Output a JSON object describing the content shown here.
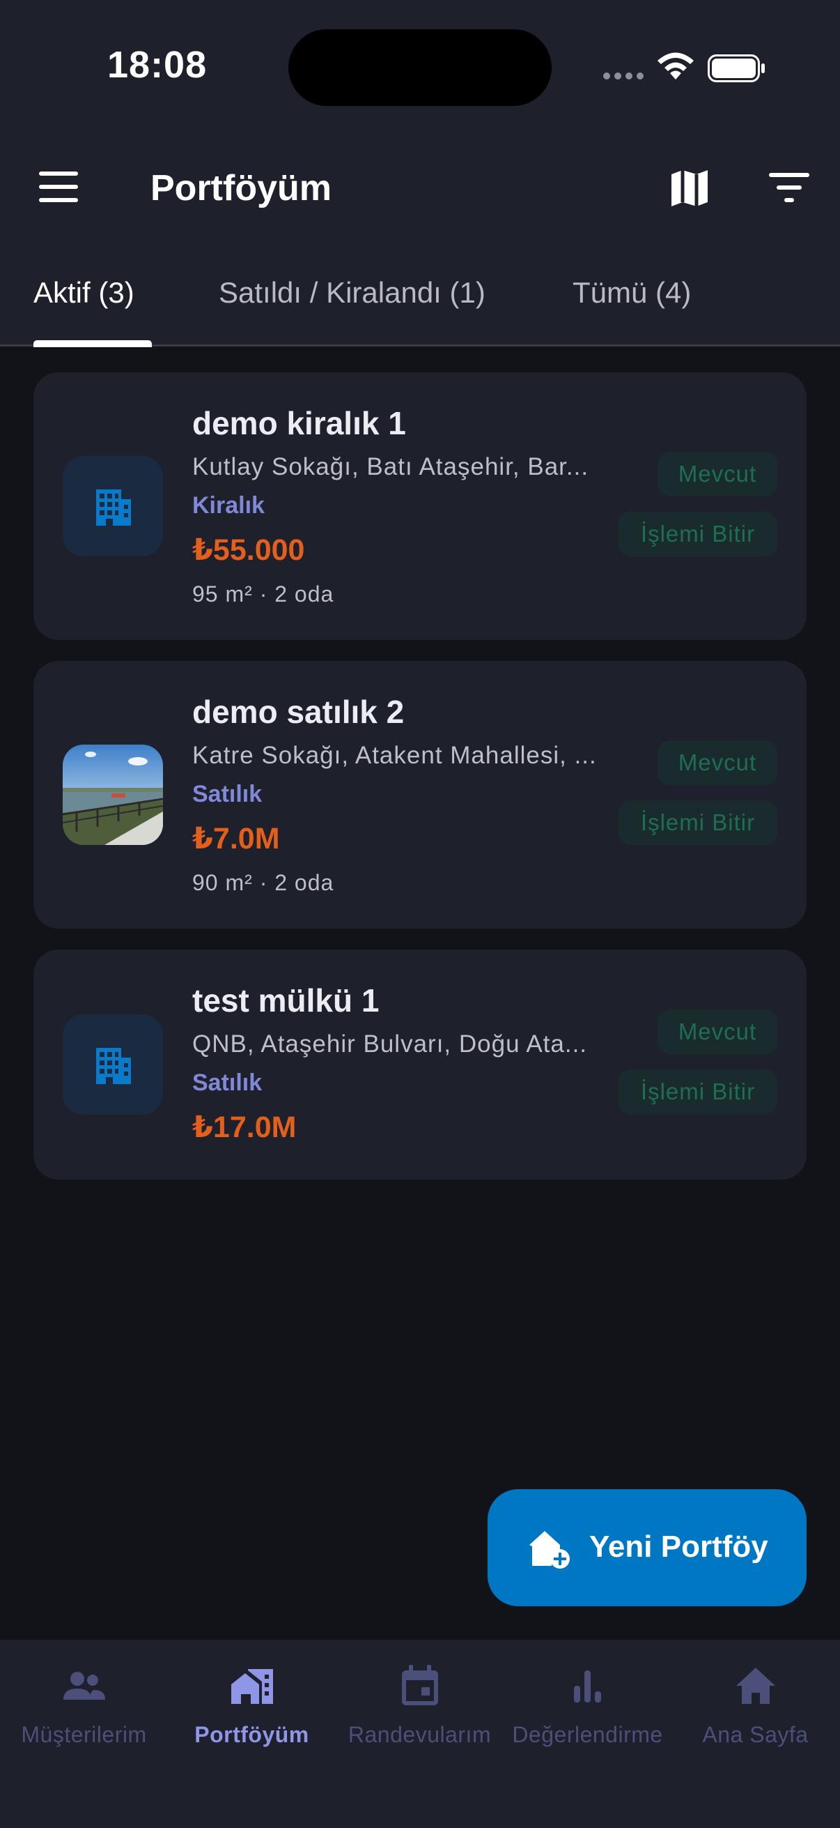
{
  "status_bar": {
    "time": "18:08"
  },
  "header": {
    "title": "Portföyüm"
  },
  "tabs": [
    {
      "label": "Aktif (3)",
      "active": true
    },
    {
      "label": "Satıldı / Kiralandı (1)",
      "active": false
    },
    {
      "label": "Tümü (4)",
      "active": false
    }
  ],
  "properties": [
    {
      "title": "demo kiralık 1",
      "address": "Kutlay Sokağı, Batı Ataşehir, Bar...",
      "type": "Kiralık",
      "price": "₺55.000",
      "meta": "95 m² · 2 oda",
      "status": "Mevcut",
      "action": "İşlemi Bitir",
      "thumb": "building-icon"
    },
    {
      "title": "demo satılık 2",
      "address": "Katre Sokağı, Atakent Mahallesi, ...",
      "type": "Satılık",
      "price": "₺7.0M",
      "meta": "90 m² · 2 oda",
      "status": "Mevcut",
      "action": "İşlemi Bitir",
      "thumb": "photo"
    },
    {
      "title": "test mülkü 1",
      "address": "QNB, Ataşehir Bulvarı, Doğu Ata...",
      "type": "Satılık",
      "price": "₺17.0M",
      "meta": "",
      "status": "Mevcut",
      "action": "İşlemi Bitir",
      "thumb": "building-icon"
    }
  ],
  "fab": {
    "label": "Yeni Portföy"
  },
  "bottom_nav": [
    {
      "label": "Müşterilerim",
      "icon": "people-icon",
      "active": false
    },
    {
      "label": "Portföyüm",
      "icon": "portfolio-icon",
      "active": true
    },
    {
      "label": "Randevularım",
      "icon": "calendar-icon",
      "active": false
    },
    {
      "label": "Değerlendirme",
      "icon": "bar-chart-icon",
      "active": false
    },
    {
      "label": "Ana Sayfa",
      "icon": "home-icon",
      "active": false
    }
  ],
  "colors": {
    "accent": "#0077C2",
    "price": "#E35F1C",
    "type": "#8088D8",
    "nav_active": "#8F96E8",
    "nav_inactive": "#4C4F7A"
  }
}
